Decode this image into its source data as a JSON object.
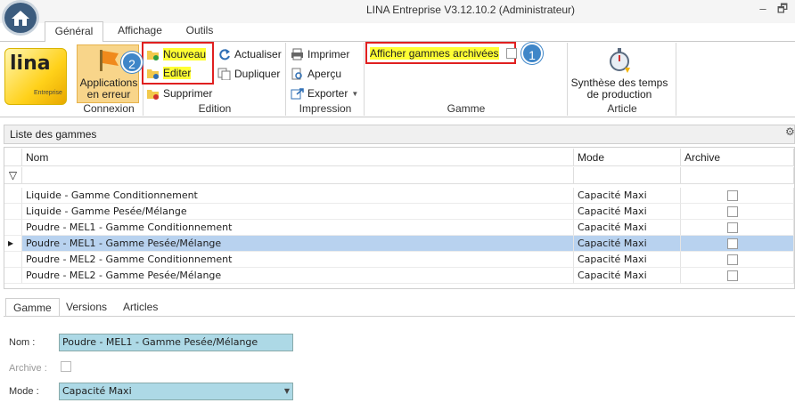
{
  "window": {
    "title": "LINA Entreprise  V3.12.10.2  (Administrateur)",
    "minimize": "–",
    "restore": "🗗"
  },
  "ribbon_tabs": [
    "Général",
    "Affichage",
    "Outils"
  ],
  "ribbon": {
    "logo_text": "lina",
    "logo_sub": "Entreprise",
    "connexion": {
      "button_label": "Applications en erreur",
      "group_label": "Connexion"
    },
    "edition": {
      "nouveau": "Nouveau",
      "editer": "Editer",
      "supprimer": "Supprimer",
      "actualiser": "Actualiser",
      "dupliquer": "Dupliquer",
      "group_label": "Edition"
    },
    "impression": {
      "imprimer": "Imprimer",
      "apercu": "Aperçu",
      "exporter": "Exporter",
      "group_label": "Impression"
    },
    "gamme": {
      "checkbox_label": "Afficher gammes archivées",
      "checked": false,
      "group_label": "Gamme"
    },
    "article": {
      "button_label": "Synthèse des temps de production",
      "group_label": "Article"
    }
  },
  "callouts": [
    "1",
    "2"
  ],
  "grid": {
    "title": "Liste des gammes",
    "columns": [
      "Nom",
      "Mode",
      "Archive"
    ],
    "rows": [
      {
        "nom": "Liquide - Gamme Conditionnement",
        "mode": "Capacité Maxi",
        "archive": false
      },
      {
        "nom": "Liquide - Gamme Pesée/Mélange",
        "mode": "Capacité Maxi",
        "archive": false
      },
      {
        "nom": "Poudre - MEL1 - Gamme Conditionnement",
        "mode": "Capacité Maxi",
        "archive": false
      },
      {
        "nom": "Poudre - MEL1 - Gamme Pesée/Mélange",
        "mode": "Capacité Maxi",
        "archive": false,
        "selected": true
      },
      {
        "nom": "Poudre - MEL2 - Gamme Conditionnement",
        "mode": "Capacité Maxi",
        "archive": false
      },
      {
        "nom": "Poudre - MEL2 - Gamme Pesée/Mélange",
        "mode": "Capacité Maxi",
        "archive": false
      }
    ]
  },
  "detail_tabs": [
    "Gamme",
    "Versions",
    "Articles"
  ],
  "detail": {
    "nom_label": "Nom :",
    "nom_value": "Poudre - MEL1 - Gamme Pesée/Mélange",
    "archive_label": "Archive :",
    "archive_checked": false,
    "mode_label": "Mode :",
    "mode_value": "Capacité Maxi"
  },
  "colors": {
    "highlight": "#ffff33",
    "callout": "#3f86c8",
    "selection": "#b8d2ef",
    "field": "#add9e6",
    "red_box": "#e02020"
  }
}
